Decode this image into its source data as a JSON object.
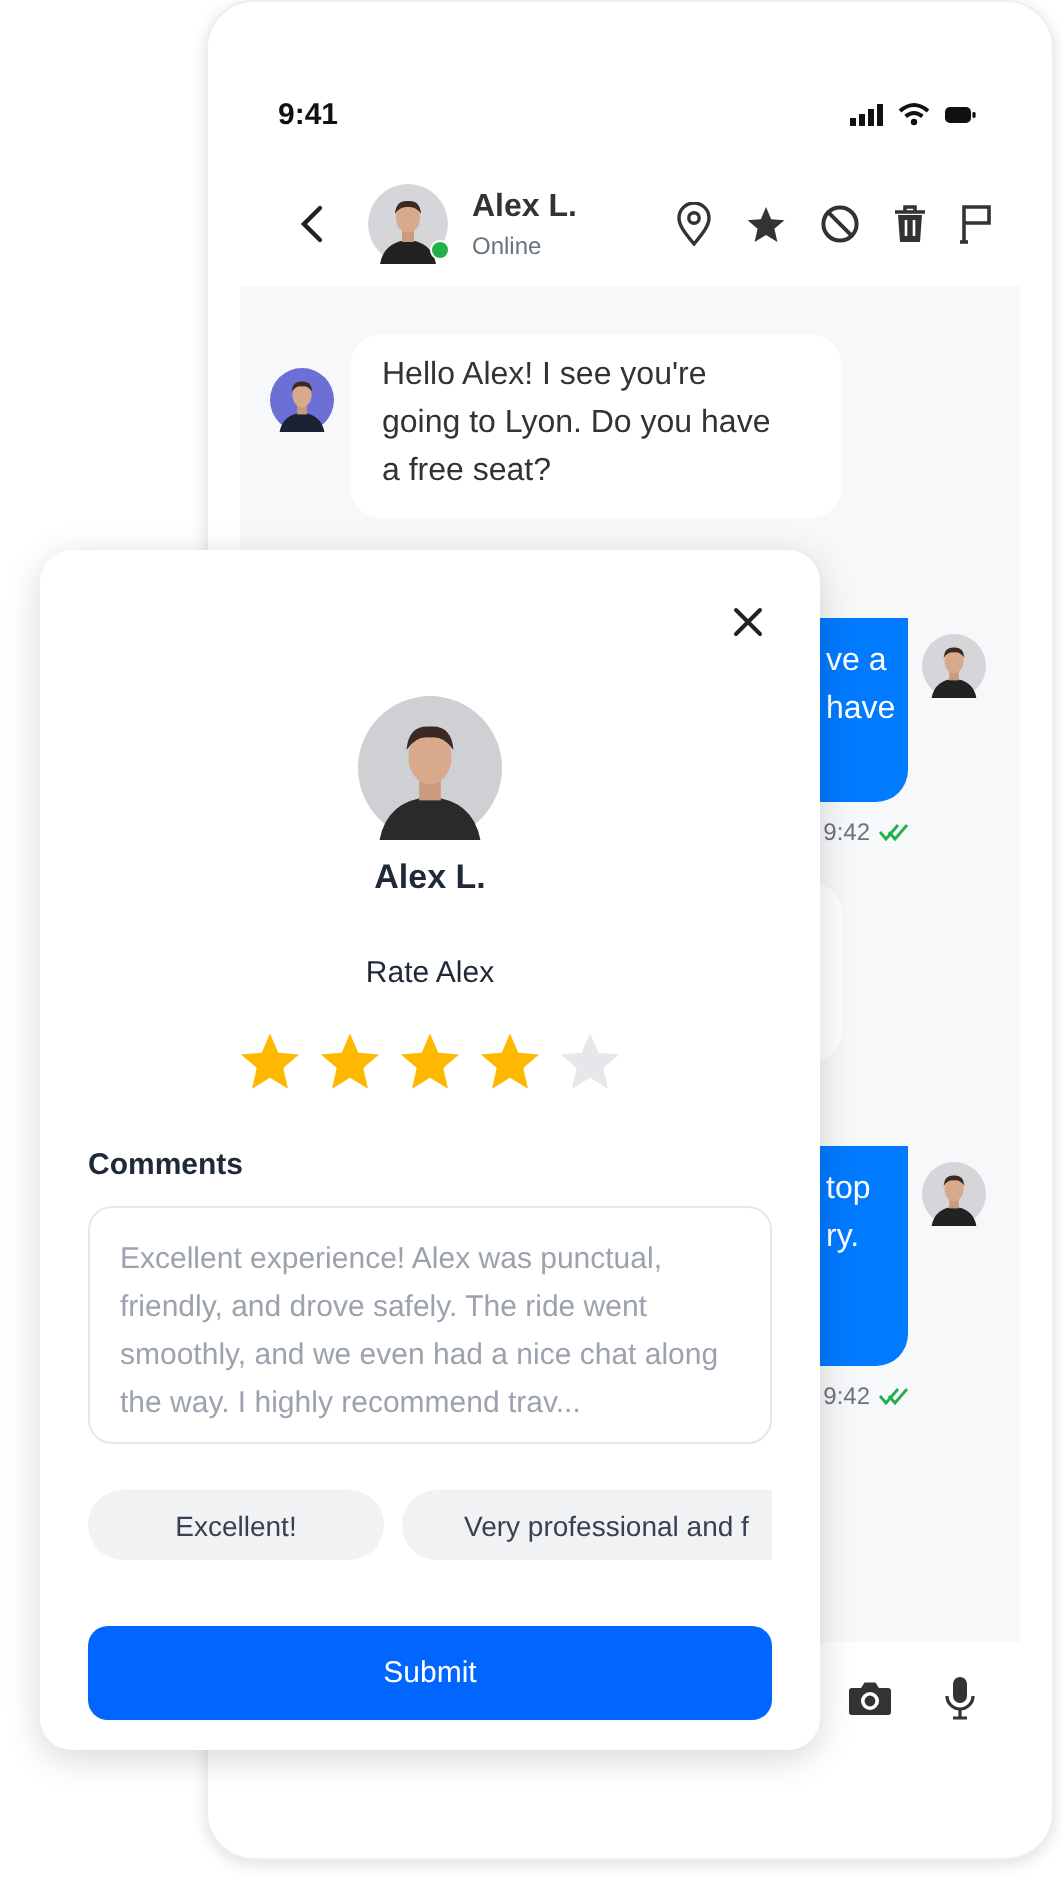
{
  "status_bar": {
    "time": "9:41"
  },
  "contact": {
    "name": "Alex L.",
    "status": "Online",
    "online": true
  },
  "messages": [
    {
      "kind": "incoming",
      "text": "Hello Alex! I see you're going to Lyon. Do you have a free seat?"
    },
    {
      "kind": "outgoing",
      "lines": [
        "ve a",
        "have"
      ],
      "time": "9:42",
      "read": true
    },
    {
      "kind": "incoming"
    },
    {
      "kind": "outgoing",
      "lines": [
        "top",
        "ry."
      ],
      "time": "9:42",
      "read": true
    }
  ],
  "rating": {
    "name": "Alex L.",
    "prompt": "Rate Alex",
    "stars": 4,
    "comments_label": "Comments",
    "placeholder": "Excellent experience! Alex was punctual, friendly, and drove safely. The ride went smoothly, and we even had a nice chat along the way. I highly recommend trav...",
    "chips": [
      "Excellent!",
      "Very professional and f"
    ],
    "submit": "Submit"
  }
}
